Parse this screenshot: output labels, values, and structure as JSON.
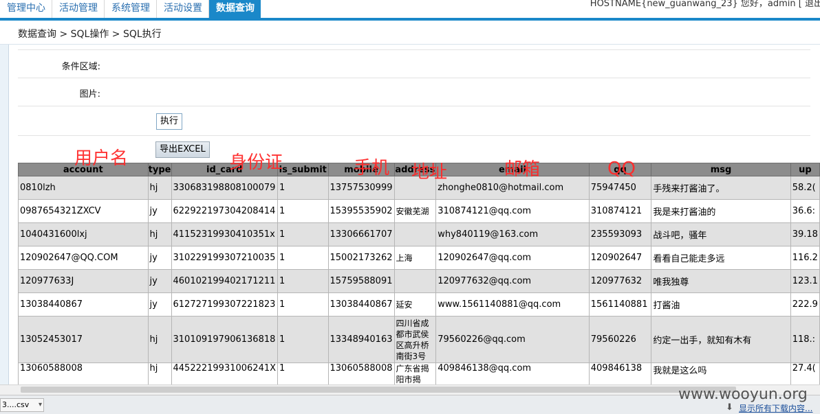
{
  "nav": {
    "tabs": [
      {
        "label": "管理中心"
      },
      {
        "label": "活动管理"
      },
      {
        "label": "系统管理"
      },
      {
        "label": "活动设置"
      },
      {
        "label": "数据查询",
        "active": true
      }
    ],
    "host_info": "HOSTNAME{new_guanwang_23} 您好，admin [ 退出"
  },
  "breadcrumb": "数据查询 > SQL操作 > SQL执行",
  "form": {
    "condition_label": "条件区域:",
    "image_label": "图片:",
    "exec_button": "执行",
    "export_button": "导出EXCEL"
  },
  "annotations": {
    "username": "用户名",
    "idcard": "身份证",
    "mobile": "手机",
    "address": "地址",
    "email": "邮箱",
    "qq": "QQ"
  },
  "table": {
    "headers": [
      "account",
      "type",
      "id_card",
      "is_submit",
      "mobile",
      "address",
      "email",
      "qq",
      "msg",
      "up"
    ],
    "rows": [
      [
        "0810lzh",
        "hj",
        "330683198808100079",
        "1",
        "13757530999",
        "",
        "zhonghe0810@hotmail.com",
        "75947450",
        "手残来打酱油了。",
        "58.2("
      ],
      [
        "0987654321ZXCV",
        "jy",
        "622922197304208414",
        "1",
        "15395535902",
        "安徽芜湖",
        "310874121@qq.com",
        "310874121",
        "我是来打酱油的",
        "36.6:"
      ],
      [
        "1040431600lxj",
        "hj",
        "41152319930410351x",
        "1",
        "13306661707",
        "",
        "why840119@163.com",
        "235593093",
        "战斗吧，骚年",
        "39.18"
      ],
      [
        "120902647@QQ.COM",
        "jy",
        "310229199307210035",
        "1",
        "15002173262",
        "上海",
        "120902647@qq.com",
        "120902647",
        "看看自己能走多远",
        "116.2"
      ],
      [
        "120977633J",
        "jy",
        "460102199402171211",
        "1",
        "15759588091",
        "",
        "120977632@qq.com",
        "120977632",
        "唯我独尊",
        "123.1"
      ],
      [
        "13038440867",
        "jy",
        "612727199307221823",
        "1",
        "13038440867",
        "延安",
        "www.1561140881@qq.com",
        "1561140881",
        "打酱油",
        "222.9"
      ],
      [
        "13052453017",
        "hj",
        "310109197906136818",
        "1",
        "13348940163",
        "四川省成都市武侯区高升桥南街3号",
        "79560226@qq.com",
        "79560226",
        "约定一出手，就知有木有",
        "118.:"
      ],
      [
        "13060588008",
        "hj",
        "44522219931006241X",
        "1",
        "13060588008",
        "广东省揭阳市揭",
        "409846138@qq.com",
        "409846138",
        "我就是这么吗",
        "27.4("
      ]
    ]
  },
  "bottom": {
    "download_item": "3....csv",
    "watermark": "www.wooyun.org",
    "show_all": "显示所有下载内容..."
  }
}
